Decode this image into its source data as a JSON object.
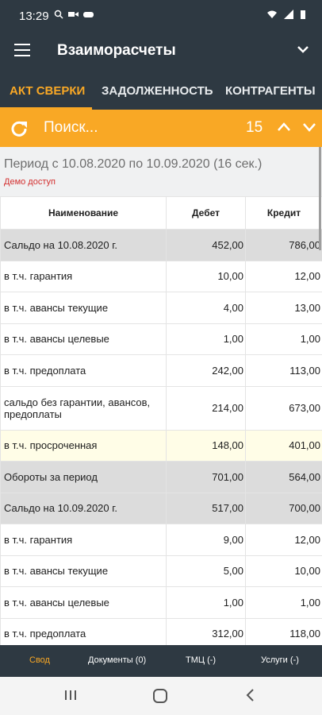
{
  "status": {
    "time": "13:29"
  },
  "app": {
    "title": "Взаиморасчеты"
  },
  "tabs": [
    {
      "label": "АКТ СВЕРКИ"
    },
    {
      "label": "ЗАДОЛЖЕННОСТЬ"
    },
    {
      "label": "КОНТРАГЕНТЫ"
    }
  ],
  "search": {
    "placeholder": "Поиск...",
    "count": "15"
  },
  "period": {
    "text": "Период с 10.08.2020 по 10.09.2020 (16 сек.)",
    "demo": "Демо доступ"
  },
  "table": {
    "headers": {
      "name": "Наименование",
      "debit": "Дебет",
      "credit": "Кредит"
    },
    "rows": [
      {
        "name": "Сальдо на 10.08.2020 г.",
        "debit": "452,00",
        "credit": "786,00"
      },
      {
        "name": "в т.ч. гарантия",
        "debit": "10,00",
        "credit": "12,00"
      },
      {
        "name": "в т.ч. авансы текущие",
        "debit": "4,00",
        "credit": "13,00"
      },
      {
        "name": "в т.ч. авансы целевые",
        "debit": "1,00",
        "credit": "1,00"
      },
      {
        "name": "в т.ч. предоплата",
        "debit": "242,00",
        "credit": "113,00"
      },
      {
        "name": "сальдо без гарантии, авансов, предоплаты",
        "debit": "214,00",
        "credit": "673,00"
      },
      {
        "name": "в т.ч. просроченная",
        "debit": "148,00",
        "credit": "401,00"
      },
      {
        "name": "Обороты за период",
        "debit": "701,00",
        "credit": "564,00"
      },
      {
        "name": "Сальдо на 10.09.2020 г.",
        "debit": "517,00",
        "credit": "700,00"
      },
      {
        "name": "в т.ч. гарантия",
        "debit": "9,00",
        "credit": "12,00"
      },
      {
        "name": "в т.ч. авансы текущие",
        "debit": "5,00",
        "credit": "10,00"
      },
      {
        "name": "в т.ч. авансы целевые",
        "debit": "1,00",
        "credit": "1,00"
      },
      {
        "name": "в т.ч. предоплата",
        "debit": "312,00",
        "credit": "118,00"
      }
    ]
  },
  "bottom_nav": [
    {
      "label": "Свод"
    },
    {
      "label": "Документы (0)"
    },
    {
      "label": "ТМЦ (-)"
    },
    {
      "label": "Услуги (-)"
    }
  ],
  "colors": {
    "primary": "#2e3942",
    "accent": "#f9a825",
    "demo": "#d32f2f"
  }
}
